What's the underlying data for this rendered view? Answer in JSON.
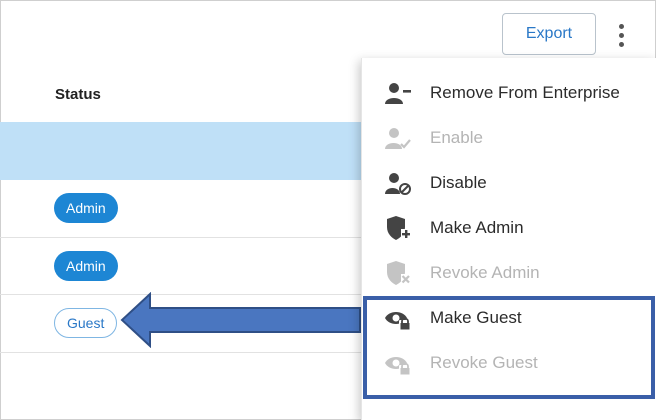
{
  "toolbar": {
    "export_label": "Export"
  },
  "table": {
    "status_header": "Status",
    "rows": [
      {
        "status": ""
      },
      {
        "status": "Admin"
      },
      {
        "status": "Admin"
      },
      {
        "status": "Guest"
      }
    ]
  },
  "menu": {
    "items": [
      {
        "label": "Remove From Enterprise",
        "icon": "remove-user-icon",
        "enabled": true
      },
      {
        "label": "Enable",
        "icon": "enable-user-icon",
        "enabled": false
      },
      {
        "label": "Disable",
        "icon": "disable-user-icon",
        "enabled": true
      },
      {
        "label": "Make Admin",
        "icon": "shield-plus-icon",
        "enabled": true
      },
      {
        "label": "Revoke Admin",
        "icon": "shield-x-icon",
        "enabled": false
      },
      {
        "label": "Make Guest",
        "icon": "guest-lock-icon",
        "enabled": true
      },
      {
        "label": "Revoke Guest",
        "icon": "guest-lock-icon",
        "enabled": false
      }
    ]
  },
  "colors": {
    "accent": "#1d86d4",
    "selected_row": "#bfe0f7",
    "annotation": "#3a5fa8",
    "disabled_text": "#b4b4b4"
  }
}
